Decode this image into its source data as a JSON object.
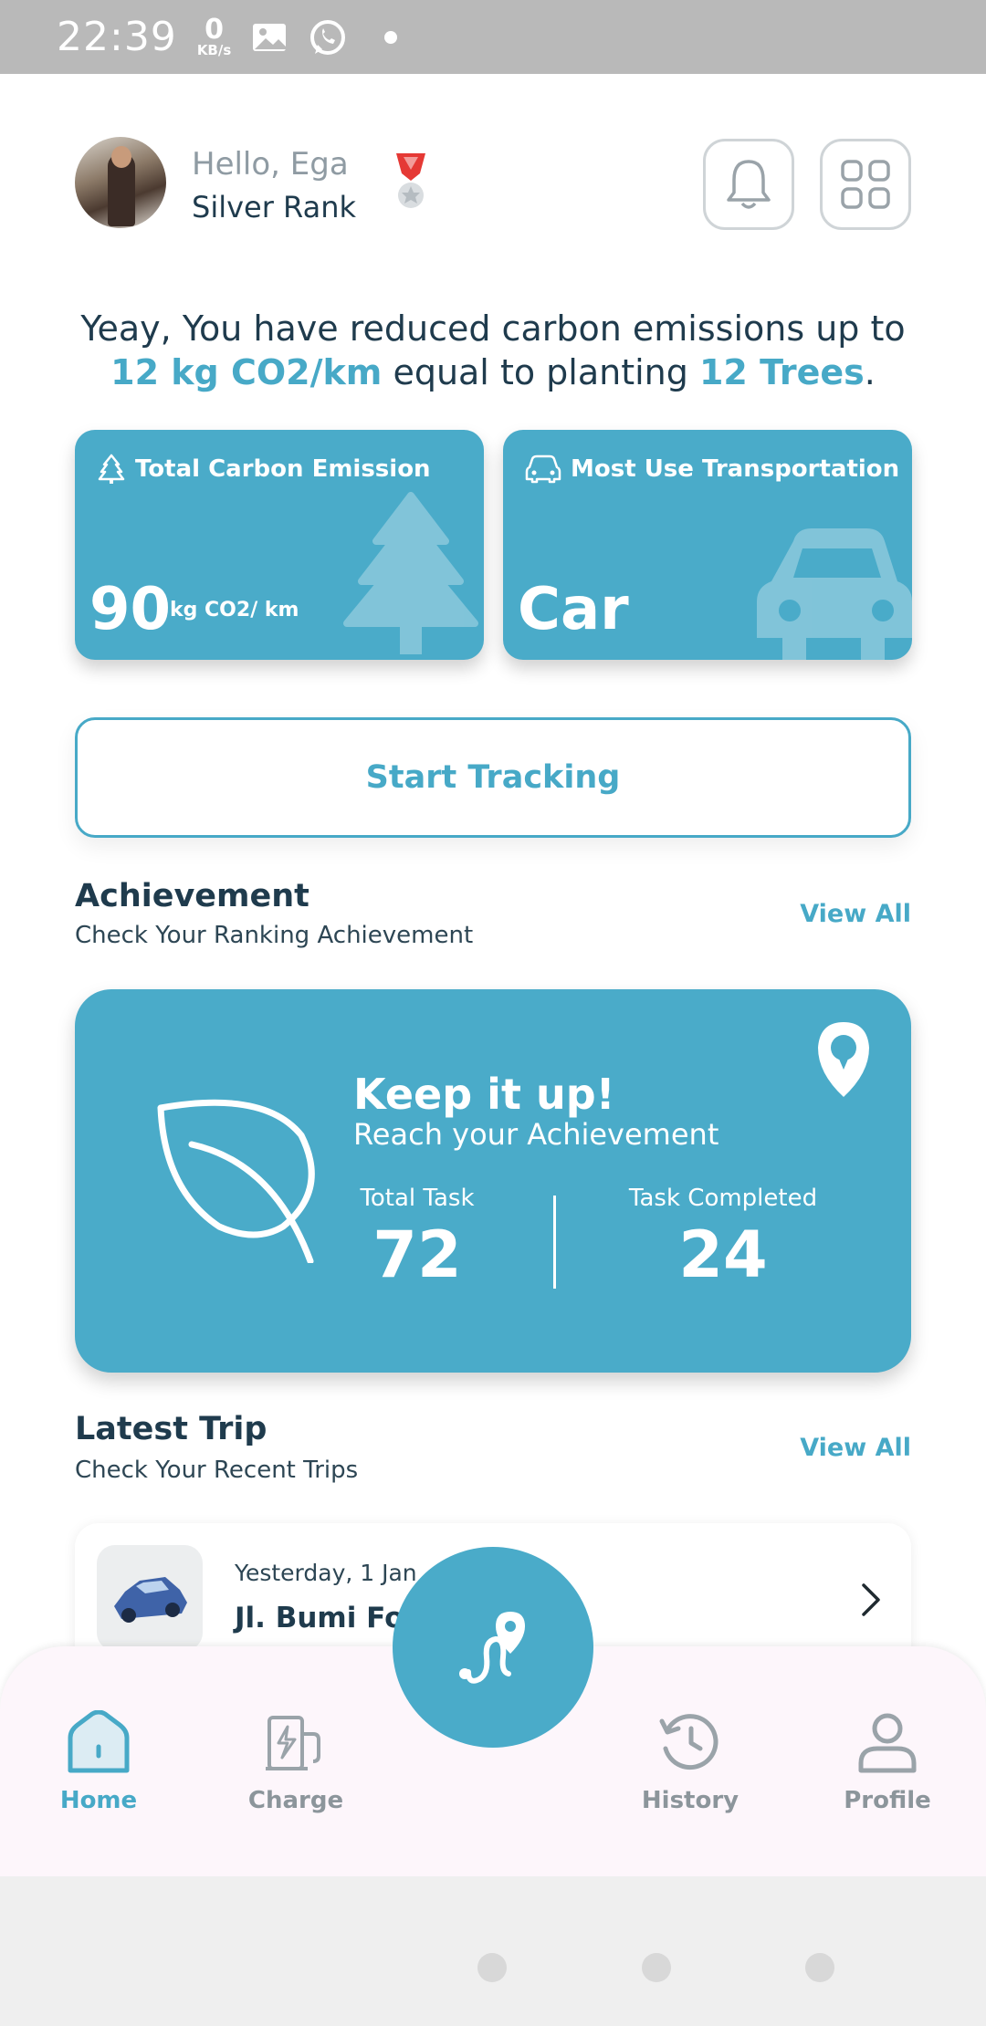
{
  "status_bar": {
    "time": "22:39",
    "net_speed": "0",
    "net_unit": "KB/s"
  },
  "header": {
    "greeting": "Hello, Ega",
    "rank": "Silver Rank"
  },
  "headline": {
    "line1": "Yeay, You have reduced carbon emissions up to",
    "emission_value": "12 kg CO2/km",
    "mid": " equal to planting ",
    "trees_value": "12 Trees",
    "end": "."
  },
  "cards": {
    "emission": {
      "title": "Total Carbon Emission",
      "value": "90",
      "unit": "kg CO2/ km"
    },
    "transport": {
      "title": "Most Use Transportation",
      "value": "Car"
    }
  },
  "track_button": "Start Tracking",
  "achievement": {
    "title": "Achievement",
    "subtitle": "Check Your Ranking Achievement",
    "view_all": "View All",
    "card": {
      "headline": "Keep it up!",
      "sub": "Reach your Achievement",
      "total_label": "Total Task",
      "total_value": "72",
      "done_label": "Task Completed",
      "done_value": "24"
    }
  },
  "latest_trip": {
    "title": "Latest Trip",
    "subtitle": "Check Your Recent Trips",
    "view_all": "View All",
    "item": {
      "date": "Yesterday, 1 Jan",
      "address": "Jl. Bumi Fo… Marg..."
    }
  },
  "nav": {
    "home": "Home",
    "charge": "Charge",
    "history": "History",
    "profile": "Profile"
  },
  "colors": {
    "accent": "#4aabc9",
    "text": "#1f3b4d",
    "muted": "#8c959b"
  }
}
